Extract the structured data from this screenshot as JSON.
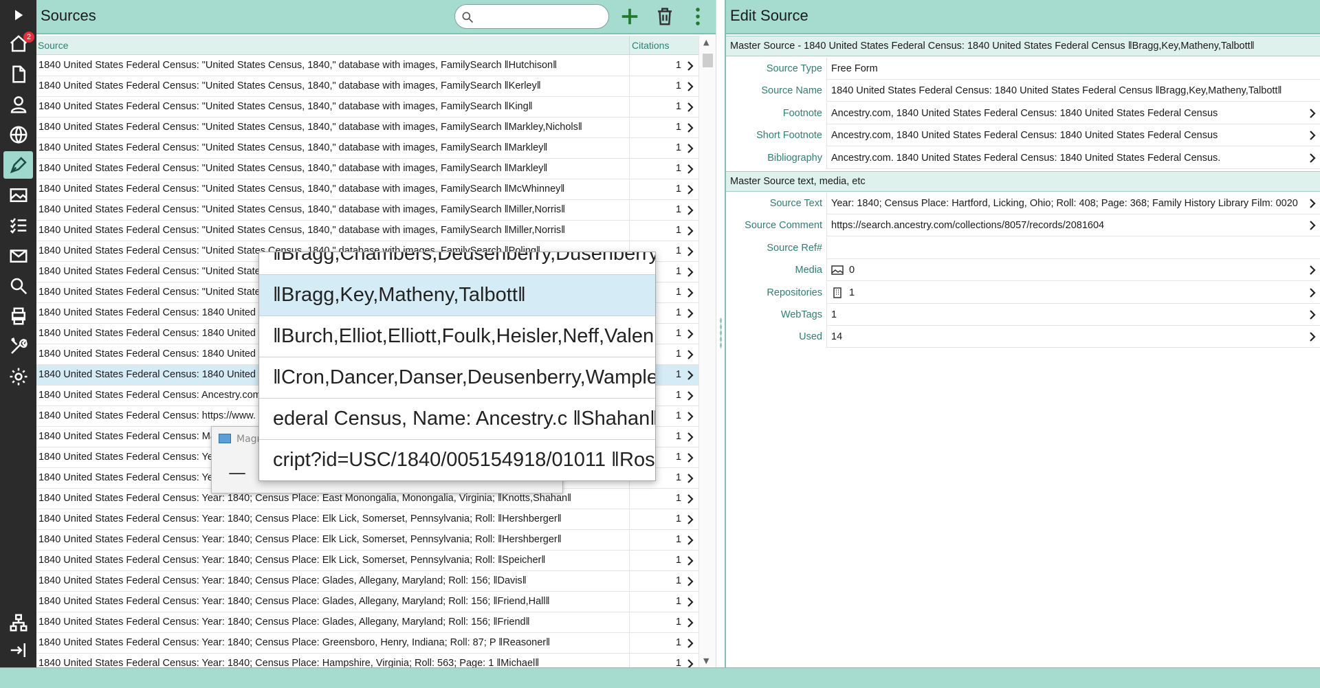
{
  "nav": {
    "badge_count": "2",
    "items": [
      "play-icon",
      "home-icon",
      "document-icon",
      "person-icon",
      "globe-icon",
      "pen-icon",
      "image-icon",
      "tasks-icon",
      "mail-icon",
      "search-icon",
      "print-icon",
      "tools-icon",
      "settings-icon",
      "family-tree-icon",
      "logout-icon"
    ]
  },
  "sources": {
    "title": "Sources",
    "search_placeholder": "",
    "columns": {
      "source": "Source",
      "citations": "Citations"
    },
    "rows": [
      {
        "text": "1840 United States Federal Census: \"United States Census, 1840,\" database with images, FamilySearch   ‖Hutchison‖",
        "count": "1"
      },
      {
        "text": "1840 United States Federal Census: \"United States Census, 1840,\" database with images, FamilySearch   ‖Kerley‖",
        "count": "1"
      },
      {
        "text": "1840 United States Federal Census: \"United States Census, 1840,\" database with images, FamilySearch   ‖King‖",
        "count": "1"
      },
      {
        "text": "1840 United States Federal Census: \"United States Census, 1840,\" database with images, FamilySearch   ‖Markley,Nichols‖",
        "count": "1"
      },
      {
        "text": "1840 United States Federal Census: \"United States Census, 1840,\" database with images, FamilySearch   ‖Markley‖",
        "count": "1"
      },
      {
        "text": "1840 United States Federal Census: \"United States Census, 1840,\" database with images, FamilySearch   ‖Markley‖",
        "count": "1"
      },
      {
        "text": "1840 United States Federal Census: \"United States Census, 1840,\" database with images, FamilySearch   ‖McWhinney‖",
        "count": "1"
      },
      {
        "text": "1840 United States Federal Census: \"United States Census, 1840,\" database with images, FamilySearch   ‖Miller,Norris‖",
        "count": "1"
      },
      {
        "text": "1840 United States Federal Census: \"United States Census, 1840,\" database with images, FamilySearch   ‖Miller,Norris‖",
        "count": "1"
      },
      {
        "text": "1840 United States Federal Census: \"United States Census, 1840,\" database with images, FamilySearch   ‖Poling‖",
        "count": "1"
      },
      {
        "text": "1840 United States Federal Census: \"United States Census, 1840,\" database with images, FamilySearch",
        "count": "1"
      },
      {
        "text": "1840 United States Federal Census: \"United States Census, 1840,\" database with images, FamilySearch",
        "count": "1"
      },
      {
        "text": "1840 United States Federal Census: 1840 United States Federal Census",
        "count": "1"
      },
      {
        "text": "1840 United States Federal Census: 1840 United States Federal Census",
        "count": "1"
      },
      {
        "text": "1840 United States Federal Census: 1840 United States Federal Census",
        "count": "1"
      },
      {
        "text": "1840 United States Federal Census: 1840 United States Federal Census",
        "count": "1"
      },
      {
        "text": "1840 United States Federal Census: Ancestry.com",
        "count": "1"
      },
      {
        "text": "1840 United States Federal Census: https://www.",
        "count": "1"
      },
      {
        "text": "1840 United States Federal Census: Ma",
        "count": "1"
      },
      {
        "text": "1840 United States Federal Census: Ye",
        "count": "1"
      },
      {
        "text": "1840 United States Federal Census: Ye",
        "count": "1"
      },
      {
        "text": "1840 United States Federal Census: Year: 1840; Census Place: East Monongalia, Monongalia, Virginia;   ‖Knotts,Shahan‖",
        "count": "1"
      },
      {
        "text": "1840 United States Federal Census: Year: 1840; Census Place: Elk Lick, Somerset, Pennsylvania; Roll:   ‖Hershberger‖",
        "count": "1"
      },
      {
        "text": "1840 United States Federal Census: Year: 1840; Census Place: Elk Lick, Somerset, Pennsylvania; Roll:   ‖Hershberger‖",
        "count": "1"
      },
      {
        "text": "1840 United States Federal Census: Year: 1840; Census Place: Elk Lick, Somerset, Pennsylvania; Roll:   ‖Speicher‖",
        "count": "1"
      },
      {
        "text": "1840 United States Federal Census: Year: 1840; Census Place: Glades, Allegany, Maryland; Roll: 156;   ‖Davis‖",
        "count": "1"
      },
      {
        "text": "1840 United States Federal Census: Year: 1840; Census Place: Glades, Allegany, Maryland; Roll: 156;   ‖Friend,Hall‖",
        "count": "1"
      },
      {
        "text": "1840 United States Federal Census: Year: 1840; Census Place: Glades, Allegany, Maryland; Roll: 156;   ‖Friend‖",
        "count": "1"
      },
      {
        "text": "1840 United States Federal Census: Year: 1840; Census Place: Greensboro, Henry, Indiana; Roll: 87; P   ‖Reasoner‖",
        "count": "1"
      },
      {
        "text": "1840 United States Federal Census: Year: 1840; Census Place: Hampshire, Virginia; Roll: 563; Page: 1   ‖Michael‖",
        "count": "1"
      }
    ],
    "selected_row": 15
  },
  "magnifier": {
    "title": "Magn",
    "items": [
      "‖Bragg,Chambers,Deusenberry,Dusenberry",
      "‖Bragg,Key,Matheny,Talbott‖",
      "‖Burch,Elliot,Elliott,Foulk,Heisler,Neff,Valen",
      "‖Cron,Dancer,Danser,Deusenberry,Wample",
      "ederal Census, Name: Ancestry.c   ‖Shahan‖",
      "cript?id=USC/1840/005154918/01011   ‖Ros"
    ],
    "highlighted": 1
  },
  "edit": {
    "title": "Edit Source",
    "master_header": "Master Source - 1840 United States Federal Census: 1840 United States Federal Census   ‖Bragg,Key,Matheny,Talbott‖",
    "fields1": [
      {
        "label": "Source Type",
        "value": "Free Form",
        "chevron": false
      },
      {
        "label": "Source Name",
        "value": "1840 United States Federal Census: 1840 United States Federal Census   ‖Bragg,Key,Matheny,Talbott‖",
        "chevron": false
      },
      {
        "label": "Footnote",
        "value": "Ancestry.com, 1840 United States Federal Census: 1840 United States Federal Census",
        "chevron": true
      },
      {
        "label": "Short Footnote",
        "value": "Ancestry.com, 1840 United States Federal Census: 1840 United States Federal Census",
        "chevron": true
      },
      {
        "label": "Bibliography",
        "value": "Ancestry.com. 1840 United States Federal Census: 1840 United States Federal Census.",
        "chevron": true
      }
    ],
    "section2": "Master Source text, media, etc",
    "fields2": [
      {
        "label": "Source Text",
        "value": "Year: 1840; Census Place: Hartford, Licking, Ohio; Roll: 408; Page: 368; Family History Library Film: 0020...",
        "chevron": true
      },
      {
        "label": "Source Comment",
        "value": "https://search.ancestry.com/collections/8057/records/2081604",
        "chevron": true
      },
      {
        "label": "Source Ref#",
        "value": "",
        "chevron": false
      },
      {
        "label": "Media",
        "value": "0",
        "chevron": true,
        "icon": "image-icon"
      },
      {
        "label": "Repositories",
        "value": "1",
        "chevron": true,
        "icon": "building-icon"
      },
      {
        "label": "WebTags",
        "value": "1",
        "chevron": true
      },
      {
        "label": "Used",
        "value": "14",
        "chevron": true
      }
    ]
  }
}
